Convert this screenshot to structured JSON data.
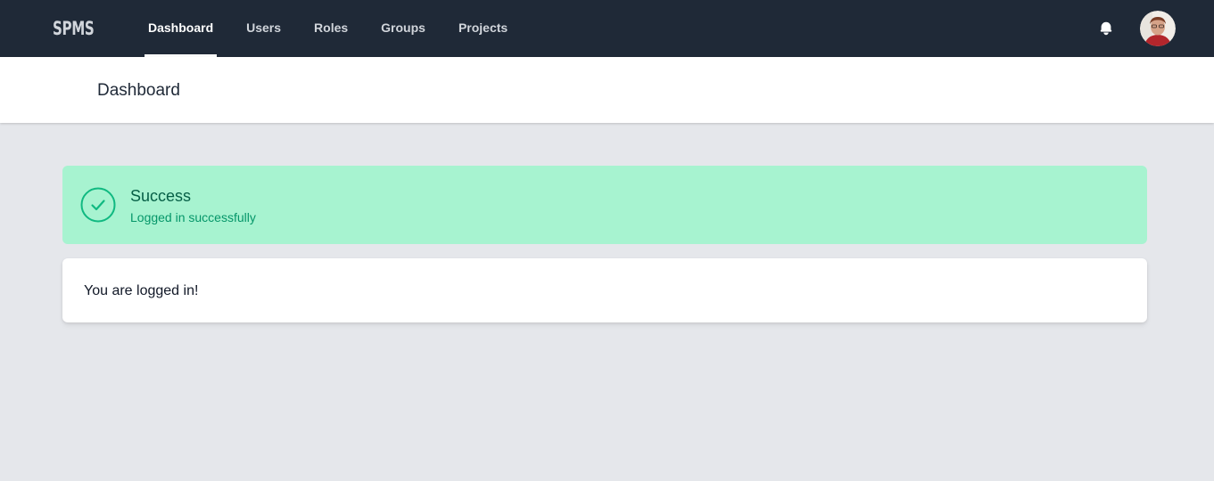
{
  "app": {
    "logo": "SPMS"
  },
  "nav": {
    "items": [
      {
        "label": "Dashboard",
        "active": true
      },
      {
        "label": "Users",
        "active": false
      },
      {
        "label": "Roles",
        "active": false
      },
      {
        "label": "Groups",
        "active": false
      },
      {
        "label": "Projects",
        "active": false
      }
    ],
    "notification_icon": "bell-icon",
    "avatar_icon": "user-avatar"
  },
  "header": {
    "title": "Dashboard"
  },
  "alert": {
    "type": "success",
    "icon": "check-circle-icon",
    "title": "Success",
    "message": "Logged in successfully"
  },
  "card": {
    "text": "You are logged in!"
  },
  "colors": {
    "navbar_bg": "#1f2937",
    "page_bg": "#e5e7eb",
    "alert_bg": "#a7f3d0",
    "alert_title": "#065f46",
    "alert_message": "#059669",
    "alert_icon": "#10b981"
  }
}
